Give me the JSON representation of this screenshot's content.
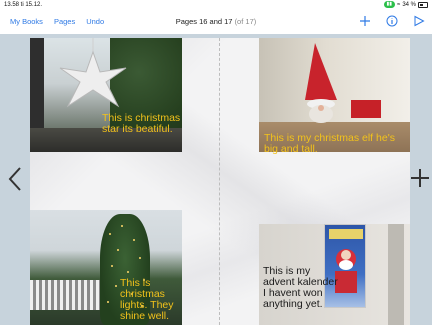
{
  "status_bar": {
    "time": "13.58  ti 15.12.",
    "battery_pct": "34 %"
  },
  "toolbar": {
    "my_books": "My Books",
    "pages": "Pages",
    "undo": "Undo",
    "title_main": "Pages 16 and 17",
    "title_sub": "(of 17)"
  },
  "photos": {
    "star": {
      "caption": "This is christmas star its beatiful."
    },
    "elf": {
      "caption": "This is my christmas elf he's big and tall."
    },
    "lights": {
      "caption": "This is christmas lights. They shine well."
    },
    "advent": {
      "caption": "This is my advent kalender I havent won anything yet."
    }
  },
  "colors": {
    "accent": "#2f7ae5",
    "caption_yellow": "#f2c21b",
    "caption_dark": "#1a1a1a",
    "canvas_bg": "#c7d3dc"
  },
  "icons": {
    "toolbar": [
      "plus-icon",
      "info-icon",
      "play-icon"
    ],
    "canvas": [
      "chevron-left-icon",
      "plus-icon"
    ]
  }
}
